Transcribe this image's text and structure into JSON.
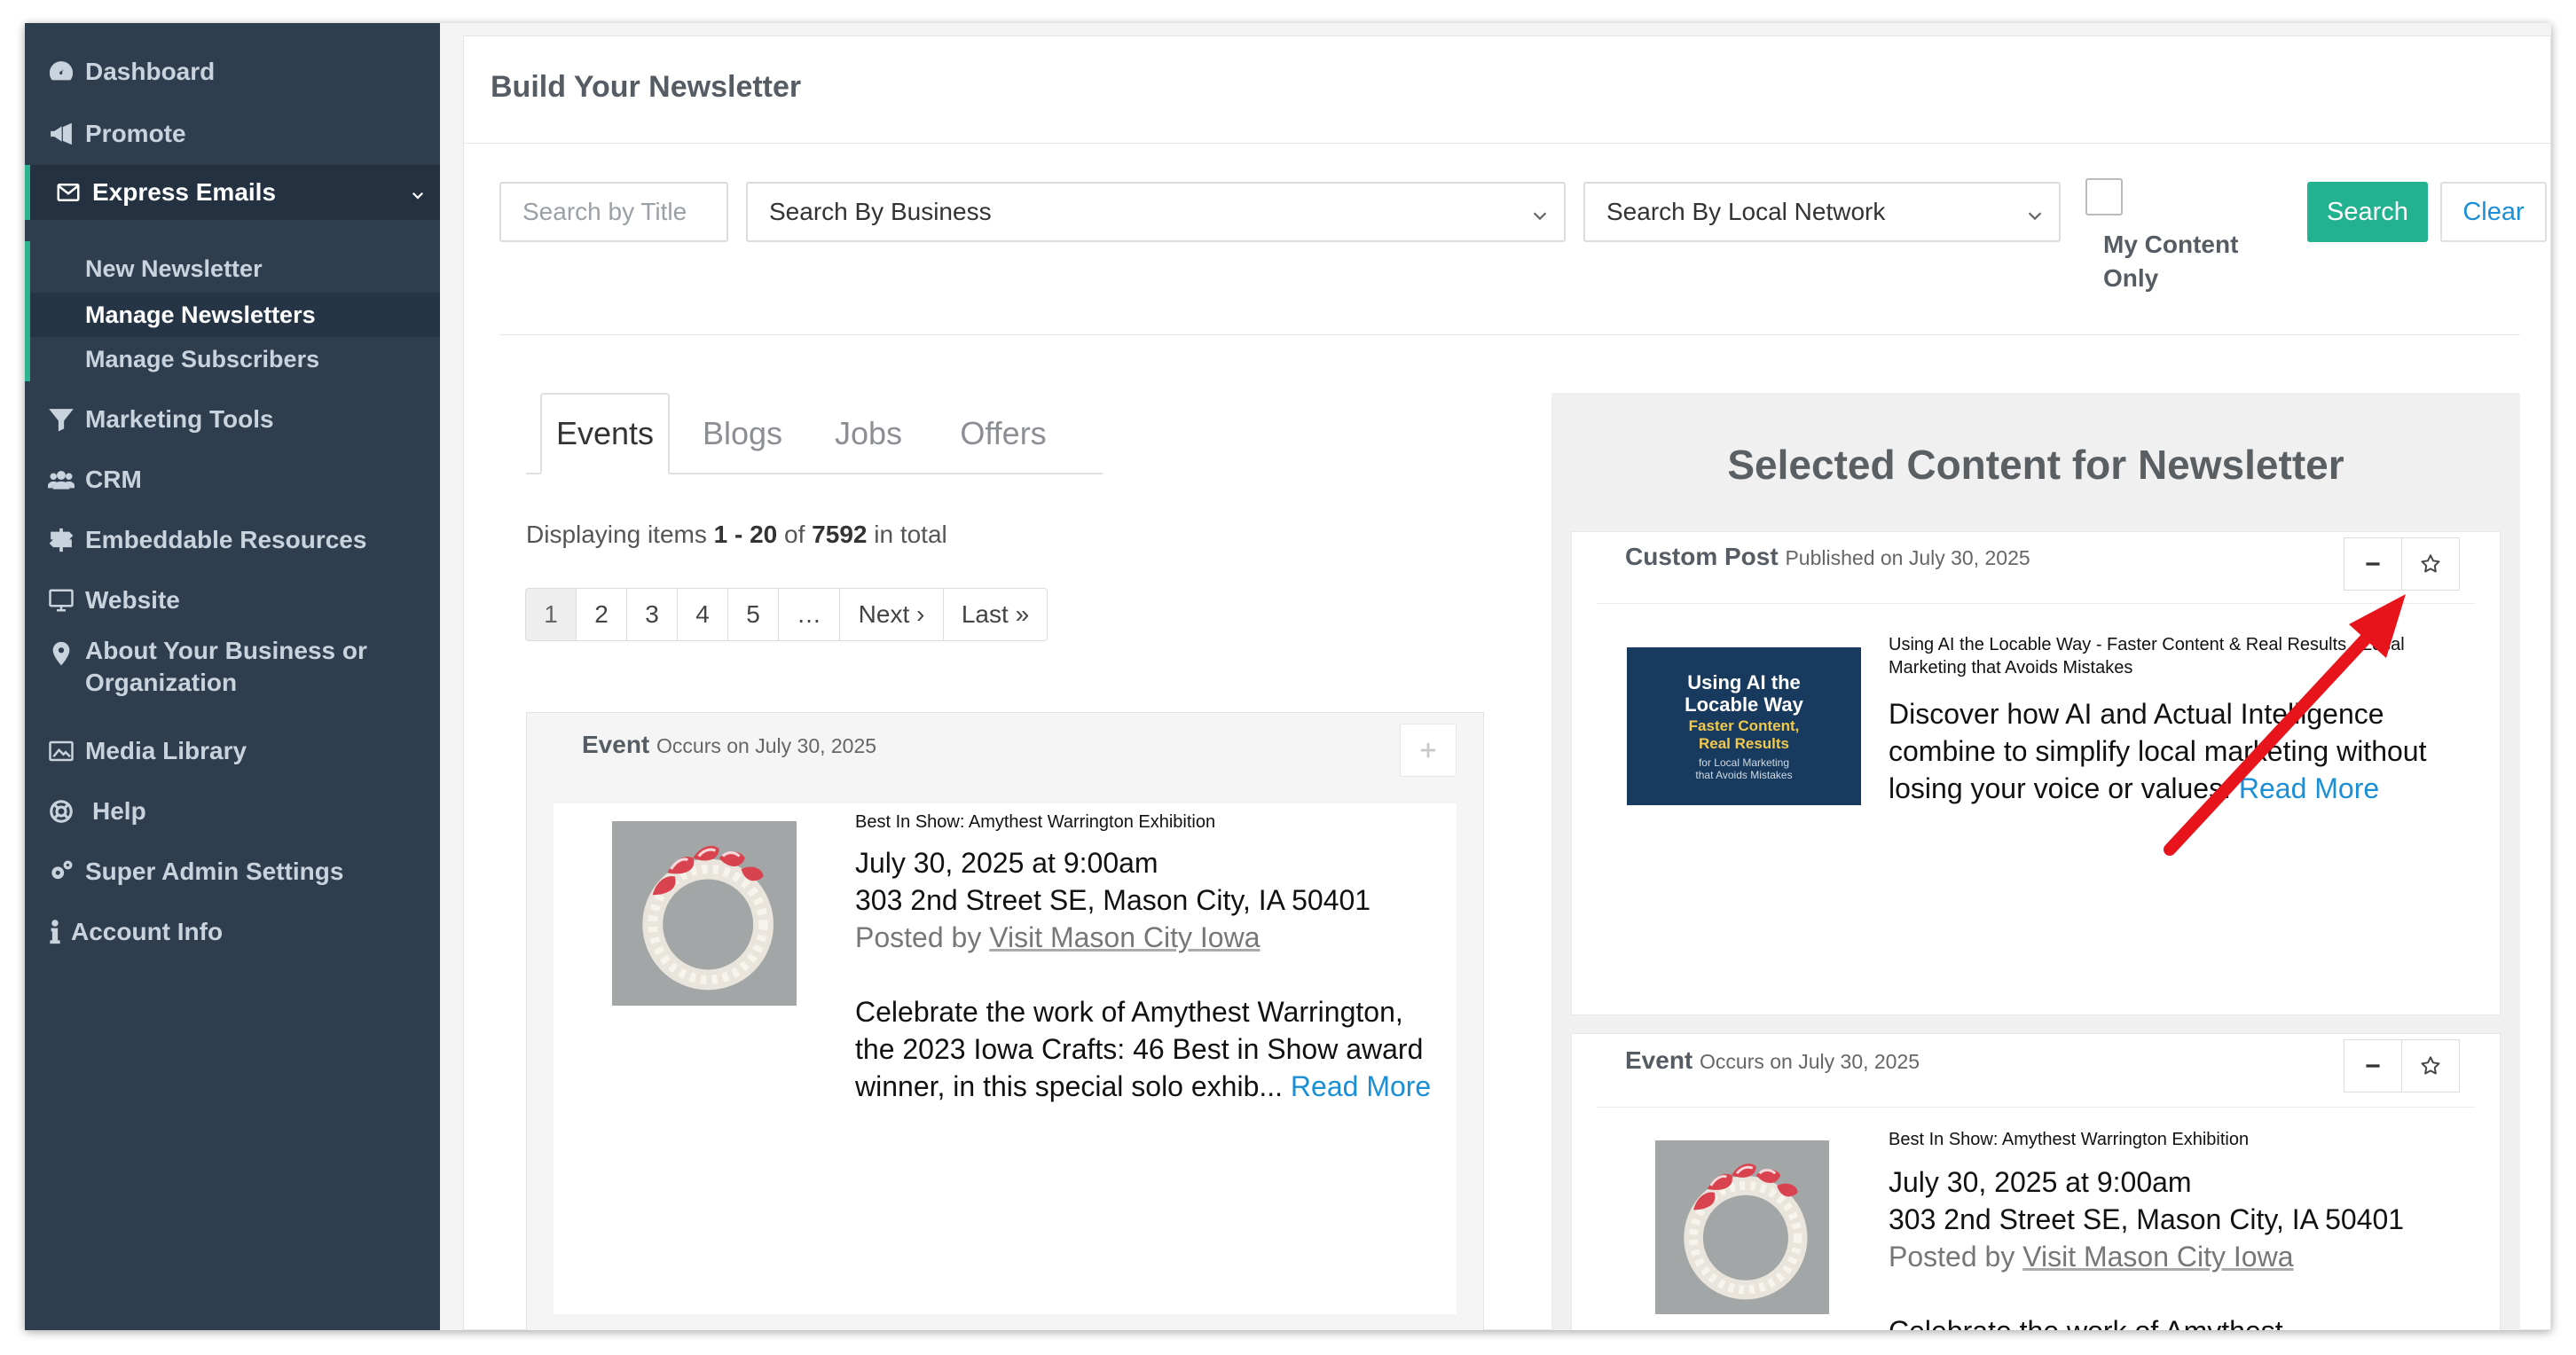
{
  "sidebar": {
    "items": [
      {
        "label": "Dashboard",
        "icon": "dashboard-icon"
      },
      {
        "label": "Promote",
        "icon": "megaphone-icon"
      },
      {
        "label": "Express Emails",
        "icon": "envelope-icon"
      },
      {
        "label": "Marketing Tools",
        "icon": "filter-icon"
      },
      {
        "label": "CRM",
        "icon": "users-icon"
      },
      {
        "label": "Embeddable Resources",
        "icon": "signpost-icon"
      },
      {
        "label": "Website",
        "icon": "monitor-icon"
      },
      {
        "label": "About Your Business or Organization",
        "icon": "map-marker-icon"
      },
      {
        "label": "Media Library",
        "icon": "image-icon"
      },
      {
        "label": "Help",
        "icon": "life-ring-icon"
      },
      {
        "label": "Super Admin Settings",
        "icon": "cogs-icon"
      },
      {
        "label": "Account Info",
        "icon": "info-icon"
      }
    ],
    "sub_items": [
      {
        "label": "New Newsletter"
      },
      {
        "label": "Manage Newsletters"
      },
      {
        "label": "Manage Subscribers"
      }
    ]
  },
  "page": {
    "title": "Build Your Newsletter"
  },
  "filters": {
    "title_placeholder": "Search by Title",
    "business_select": "Search By Business",
    "network_select": "Search By Local Network",
    "my_content_label": "My Content Only",
    "search_label": "Search",
    "clear_label": "Clear"
  },
  "tabs": [
    "Events",
    "Blogs",
    "Jobs",
    "Offers"
  ],
  "listing": {
    "prefix": "Displaying items ",
    "range": "1 - 20",
    "of": " of ",
    "total": "7592",
    "suffix": " in total"
  },
  "pagination": [
    "1",
    "2",
    "3",
    "4",
    "5",
    "…",
    "Next ›",
    "Last »"
  ],
  "event_card": {
    "type": "Event",
    "meta": "Occurs on July 30, 2025",
    "small_title": "Best In Show: Amythest Warrington Exhibition",
    "date": "July 30, 2025 at 9:00am",
    "address": "303 2nd Street SE, Mason City, IA 50401",
    "posted_by_prefix": "Posted by ",
    "posted_by": "Visit Mason City Iowa",
    "description": "Celebrate the work of Amythest Warrington, the 2023 Iowa Crafts: 46 Best in Show award winner, in this special solo exhib...",
    "read_more": "Read More"
  },
  "selected": {
    "title": "Selected Content for Newsletter",
    "custom_post": {
      "type": "Custom Post",
      "meta": "Published on July 30, 2025",
      "small_title": "Using AI the Locable Way - Faster Content & Real Results - Local Marketing that Avoids Mistakes",
      "thumb_line1": "Using AI the",
      "thumb_line2": "Locable Way",
      "thumb_line3": "Faster Content,",
      "thumb_line4": "Real Results",
      "thumb_line5": "for Local Marketing",
      "thumb_line6": "that Avoids Mistakes",
      "description": "Discover how AI and Actual Intelligence combine to simplify local marketing without losing your voice or values.",
      "read_more": "Read More"
    },
    "event": {
      "type": "Event",
      "meta": "Occurs on July 30, 2025",
      "small_title": "Best In Show: Amythest Warrington Exhibition",
      "date": "July 30, 2025 at 9:00am",
      "address": "303 2nd Street SE, Mason City, IA 50401",
      "posted_by_prefix": "Posted by ",
      "posted_by": "Visit Mason City Iowa",
      "description_start": "Celebrate the work of Amythest"
    }
  },
  "colors": {
    "sidebar_bg": "#2e3e4e",
    "accent_green": "#22b28f",
    "link_blue": "#1a8fd6",
    "annotation_red": "#e8141b"
  }
}
